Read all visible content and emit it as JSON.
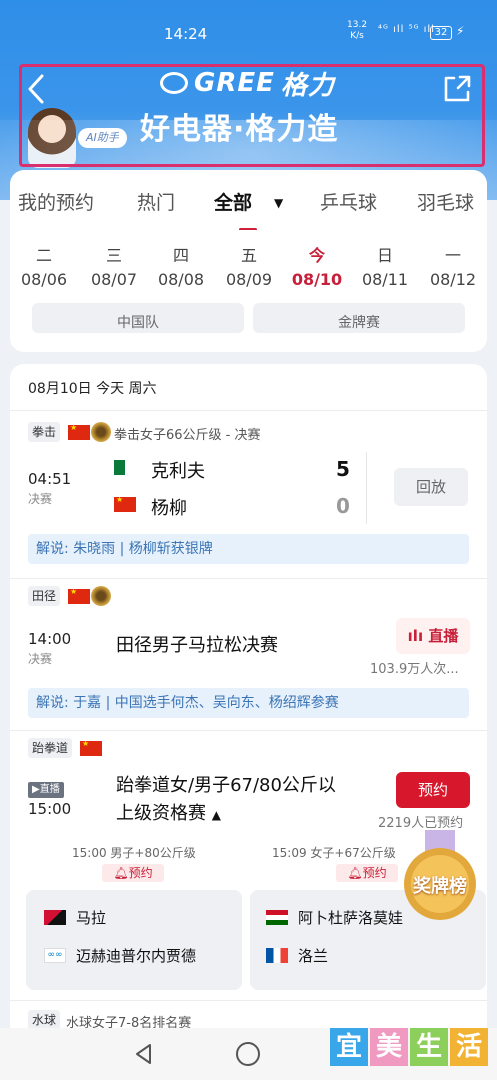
{
  "status": {
    "time": "14:24",
    "speed_top": "13.2",
    "speed_bottom": "K/s",
    "signal": "⁴ᴳ ıll ⁵ᴳ ıll",
    "battery": "32"
  },
  "header": {
    "brand": "GREE",
    "brand_cn": "格力",
    "slogan": "好电器·格力造",
    "ai_label": "AI助手"
  },
  "tabs": [
    "我的预约",
    "热门",
    "全部",
    "乒乓球",
    "羽毛球"
  ],
  "active_tab": "全部",
  "dates": [
    {
      "dow": "二",
      "date": "08/06"
    },
    {
      "dow": "三",
      "date": "08/07"
    },
    {
      "dow": "四",
      "date": "08/08"
    },
    {
      "dow": "五",
      "date": "08/09"
    },
    {
      "dow": "今",
      "date": "08/10"
    },
    {
      "dow": "日",
      "date": "08/11"
    },
    {
      "dow": "一",
      "date": "08/12"
    }
  ],
  "filters": [
    "中国队",
    "金牌赛"
  ],
  "day_header": "08月10日 今天 周六",
  "match1": {
    "sport": "拳击",
    "event": "拳击女子66公斤级 - 决赛",
    "time": "04:51",
    "state": "决赛",
    "team_a": "克利夫",
    "score_a": "5",
    "team_b": "杨柳",
    "score_b": "0",
    "action": "回放",
    "commentary": "解说: 朱晓雨 | 杨柳斩获银牌"
  },
  "match2": {
    "sport": "田径",
    "time": "14:00",
    "state": "决赛",
    "title": "田径男子马拉松决赛",
    "action": "直播",
    "viewers": "103.9万人次...",
    "commentary": "解说: 于嘉 | 中国选手何杰、吴向东、杨绍辉参赛"
  },
  "match3": {
    "sport": "跆拳道",
    "live_pill": "▶直播",
    "time": "15:00",
    "title_line1": "跆拳道女/男子67/80公斤以",
    "title_line2": "上级资格赛",
    "action": "预约",
    "reserved": "2219人已预约",
    "sub1": {
      "time": "15:00 男子+80公斤级",
      "remind": "预约",
      "ath1": "马拉",
      "ath2": "迈赫迪普尔内贾德"
    },
    "sub2": {
      "time": "15:09 女子+67公斤级",
      "remind": "预约",
      "ath1": "阿卜杜萨洛莫娃",
      "ath2": "洛兰"
    }
  },
  "match4": {
    "sport": "水球",
    "event": "水球女子7-8名排名赛"
  },
  "medal_badge": "奖牌榜",
  "watermark": [
    "宜",
    "美",
    "生",
    "活"
  ],
  "colors": {
    "header_blue": "#2f8ee8",
    "accent_red": "#c8203a",
    "frame_pink": "#d92f6e"
  }
}
